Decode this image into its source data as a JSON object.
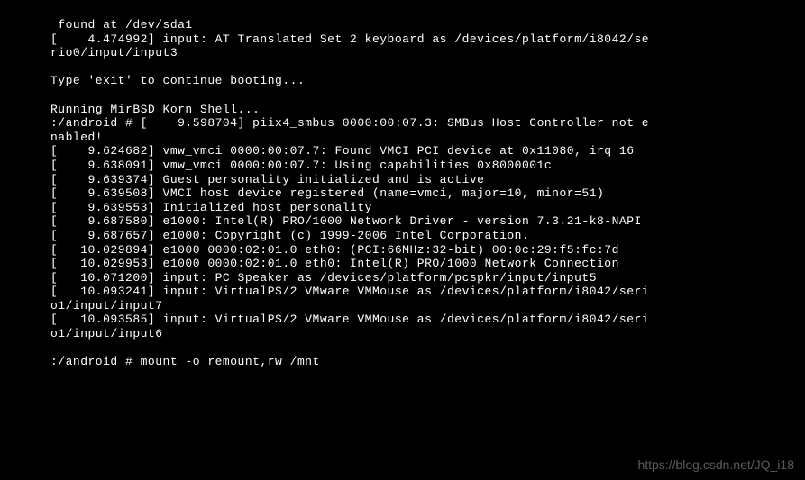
{
  "terminal": {
    "lines": [
      " found at /dev/sda1",
      "[    4.474992] input: AT Translated Set 2 keyboard as /devices/platform/i8042/se",
      "rio0/input/input3",
      "",
      "Type 'exit' to continue booting...",
      "",
      "Running MirBSD Korn Shell...",
      ":/android # [    9.598704] piix4_smbus 0000:00:07.3: SMBus Host Controller not e",
      "nabled!",
      "[    9.624682] vmw_vmci 0000:00:07.7: Found VMCI PCI device at 0x11080, irq 16",
      "[    9.638091] vmw_vmci 0000:00:07.7: Using capabilities 0x8000001c",
      "[    9.639374] Guest personality initialized and is active",
      "[    9.639508] VMCI host device registered (name=vmci, major=10, minor=51)",
      "[    9.639553] Initialized host personality",
      "[    9.687580] e1000: Intel(R) PRO/1000 Network Driver - version 7.3.21-k8-NAPI",
      "[    9.687657] e1000: Copyright (c) 1999-2006 Intel Corporation.",
      "[   10.029894] e1000 0000:02:01.0 eth0: (PCI:66MHz:32-bit) 00:0c:29:f5:fc:7d",
      "[   10.029953] e1000 0000:02:01.0 eth0: Intel(R) PRO/1000 Network Connection",
      "[   10.071200] input: PC Speaker as /devices/platform/pcspkr/input/input5",
      "[   10.093241] input: VirtualPS/2 VMware VMMouse as /devices/platform/i8042/seri",
      "o1/input/input7",
      "[   10.093585] input: VirtualPS/2 VMware VMMouse as /devices/platform/i8042/seri",
      "o1/input/input6",
      "",
      ":/android # mount -o remount,rw /mnt"
    ]
  },
  "watermark": "https://blog.csdn.net/JQ_i18"
}
